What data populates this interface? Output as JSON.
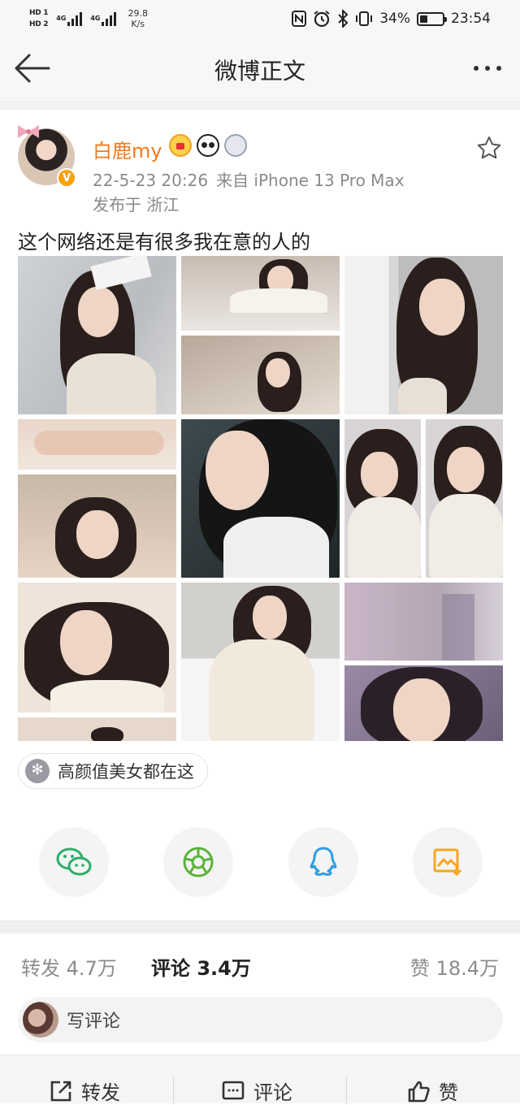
{
  "status_bar": {
    "sim1": "HD 1",
    "sim2": "HD 2",
    "signal1": "4G",
    "signal2": "4G",
    "net_speed_value": "29.8",
    "net_speed_unit": "K/s",
    "icons": [
      "nfc-icon",
      "alarm-icon",
      "bluetooth-icon",
      "vibrate-icon"
    ],
    "battery": "34%",
    "battery_level": 0.34,
    "time": "23:54"
  },
  "header": {
    "title": "微博正文",
    "back_icon": "arrow-left-icon",
    "more_icon": "more-dots-icon"
  },
  "post": {
    "username": "白鹿my",
    "verified_badge": "V",
    "badges": [
      "crown-icon",
      "panda-icon",
      "medal-icon"
    ],
    "time": "22-5-23 20:26",
    "source": "来自 iPhone 13 Pro Max",
    "location": "发布于 浙江",
    "text": "这个网络还是有很多我在意的人的",
    "photo_count": 9,
    "topic": "高颜值美女都在这"
  },
  "share": {
    "items": [
      "wechat-icon",
      "moments-icon",
      "qq-icon",
      "save-image-icon"
    ],
    "colors": {
      "wechat": "#2aae67",
      "moments": "#5ab43a",
      "qq": "#2e9de2",
      "save": "#f5a623"
    }
  },
  "stats": {
    "repost": "转发 4.7万",
    "comment": "评论 3.4万",
    "like": "赞 18.4万"
  },
  "comment_box": {
    "placeholder": "写评论"
  },
  "bottom_bar": {
    "repost": "转发",
    "comment": "评论",
    "like": "赞"
  },
  "colors": {
    "username": "#f07a1e",
    "verified": "#f5a30f",
    "meta": "#8a8a8a"
  }
}
